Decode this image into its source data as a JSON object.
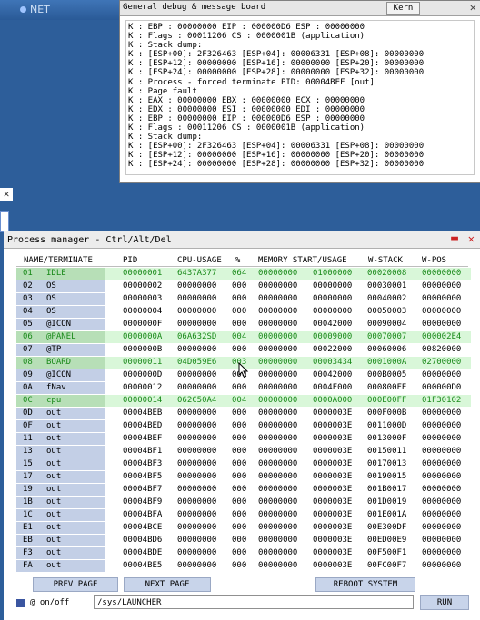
{
  "desktop": {
    "net_label": "NET"
  },
  "debug": {
    "title": "General debug & message board",
    "kern_label": "Kern",
    "close_glyph": "✕",
    "lines": [
      "K : EBP : 00000000 EIP : 000000D6 ESP : 00000000",
      "K : Flags : 00011206 CS : 0000001B (application)",
      "K : Stack dump:",
      "K : [ESP+00]: 2F326463 [ESP+04]: 00006331 [ESP+08]: 00000000",
      "K : [ESP+12]: 00000000 [ESP+16]: 00000000 [ESP+20]: 00000000",
      "K : [ESP+24]: 00000000 [ESP+28]: 00000000 [ESP+32]: 00000000",
      "K : Process - forced terminate PID: 00004BEF [out]",
      "K : Page fault",
      "K : EAX : 00000000 EBX : 00000000 ECX : 00000000",
      "K : EDX : 00000000 ESI : 00000000 EDI : 00000000",
      "K : EBP : 00000000 EIP : 000000D6 ESP : 00000000",
      "K : Flags : 00011206 CS : 0000001B (application)",
      "K : Stack dump:",
      "K : [ESP+00]: 2F326463 [ESP+04]: 00006331 [ESP+08]: 00000000",
      "K : [ESP+12]: 00000000 [ESP+16]: 00000000 [ESP+20]: 00000000",
      "K : [ESP+24]: 00000000 [ESP+28]: 00000000 [ESP+32]: 00000000"
    ]
  },
  "pm": {
    "title": "Process manager - Ctrl/Alt/Del",
    "minimize_glyph": "▬",
    "close_glyph": "✕",
    "headers": [
      "NAME/TERMINATE",
      "PID",
      "CPU-USAGE",
      "%",
      "MEMORY START/USAGE",
      "W-STACK",
      "W-POS"
    ],
    "rows": [
      {
        "id": "01",
        "name": "IDLE",
        "pid": "00000001",
        "cpu": "6437A377",
        "pct": "064",
        "mem1": "00000000",
        "mem2": "01000000",
        "wstack": "00020008",
        "wpos": "00000000",
        "hl": true
      },
      {
        "id": "02",
        "name": "OS",
        "pid": "00000002",
        "cpu": "00000000",
        "pct": "000",
        "mem1": "00000000",
        "mem2": "00000000",
        "wstack": "00030001",
        "wpos": "00000000",
        "hl": false
      },
      {
        "id": "03",
        "name": "OS",
        "pid": "00000003",
        "cpu": "00000000",
        "pct": "000",
        "mem1": "00000000",
        "mem2": "00000000",
        "wstack": "00040002",
        "wpos": "00000000",
        "hl": false
      },
      {
        "id": "04",
        "name": "OS",
        "pid": "00000004",
        "cpu": "00000000",
        "pct": "000",
        "mem1": "00000000",
        "mem2": "00000000",
        "wstack": "00050003",
        "wpos": "00000000",
        "hl": false
      },
      {
        "id": "05",
        "name": "@ICON",
        "pid": "0000000F",
        "cpu": "00000000",
        "pct": "000",
        "mem1": "00000000",
        "mem2": "00042000",
        "wstack": "00090004",
        "wpos": "00000000",
        "hl": false
      },
      {
        "id": "06",
        "name": "@PANEL",
        "pid": "0000000A",
        "cpu": "06A632SD",
        "pct": "004",
        "mem1": "00000000",
        "mem2": "00009000",
        "wstack": "00070007",
        "wpos": "000002E4",
        "hl": true
      },
      {
        "id": "07",
        "name": "@TP",
        "pid": "0000000B",
        "cpu": "00000000",
        "pct": "000",
        "mem1": "00000000",
        "mem2": "00022000",
        "wstack": "00060006",
        "wpos": "00820000",
        "hl": false
      },
      {
        "id": "08",
        "name": "BOARD",
        "pid": "00000011",
        "cpu": "04D059E6",
        "pct": "003",
        "mem1": "00000000",
        "mem2": "00003434",
        "wstack": "0001000A",
        "wpos": "02700000",
        "hl": true
      },
      {
        "id": "09",
        "name": "@ICON",
        "pid": "0000000D",
        "cpu": "00000000",
        "pct": "000",
        "mem1": "00000000",
        "mem2": "00042000",
        "wstack": "000B0005",
        "wpos": "00000000",
        "hl": false
      },
      {
        "id": "0A",
        "name": "fNav",
        "pid": "00000012",
        "cpu": "00000000",
        "pct": "000",
        "mem1": "00000000",
        "mem2": "0004F000",
        "wstack": "000800FE",
        "wpos": "000000D0",
        "hl": false
      },
      {
        "id": "0C",
        "name": "cpu",
        "pid": "00000014",
        "cpu": "062C50A4",
        "pct": "004",
        "mem1": "00000000",
        "mem2": "0000A000",
        "wstack": "000E00FF",
        "wpos": "01F30102",
        "hl": true
      },
      {
        "id": "0D",
        "name": "out",
        "pid": "00004BEB",
        "cpu": "00000000",
        "pct": "000",
        "mem1": "00000000",
        "mem2": "0000003E",
        "wstack": "000F000B",
        "wpos": "00000000",
        "hl": false
      },
      {
        "id": "0F",
        "name": "out",
        "pid": "00004BED",
        "cpu": "00000000",
        "pct": "000",
        "mem1": "00000000",
        "mem2": "0000003E",
        "wstack": "0011000D",
        "wpos": "00000000",
        "hl": false
      },
      {
        "id": "11",
        "name": "out",
        "pid": "00004BEF",
        "cpu": "00000000",
        "pct": "000",
        "mem1": "00000000",
        "mem2": "0000003E",
        "wstack": "0013000F",
        "wpos": "00000000",
        "hl": false
      },
      {
        "id": "13",
        "name": "out",
        "pid": "00004BF1",
        "cpu": "00000000",
        "pct": "000",
        "mem1": "00000000",
        "mem2": "0000003E",
        "wstack": "00150011",
        "wpos": "00000000",
        "hl": false
      },
      {
        "id": "15",
        "name": "out",
        "pid": "00004BF3",
        "cpu": "00000000",
        "pct": "000",
        "mem1": "00000000",
        "mem2": "0000003E",
        "wstack": "00170013",
        "wpos": "00000000",
        "hl": false
      },
      {
        "id": "17",
        "name": "out",
        "pid": "00004BF5",
        "cpu": "00000000",
        "pct": "000",
        "mem1": "00000000",
        "mem2": "0000003E",
        "wstack": "00190015",
        "wpos": "00000000",
        "hl": false
      },
      {
        "id": "19",
        "name": "out",
        "pid": "00004BF7",
        "cpu": "00000000",
        "pct": "000",
        "mem1": "00000000",
        "mem2": "0000003E",
        "wstack": "001B0017",
        "wpos": "00000000",
        "hl": false
      },
      {
        "id": "1B",
        "name": "out",
        "pid": "00004BF9",
        "cpu": "00000000",
        "pct": "000",
        "mem1": "00000000",
        "mem2": "0000003E",
        "wstack": "001D0019",
        "wpos": "00000000",
        "hl": false
      },
      {
        "id": "1C",
        "name": "out",
        "pid": "00004BFA",
        "cpu": "00000000",
        "pct": "000",
        "mem1": "00000000",
        "mem2": "0000003E",
        "wstack": "001E001A",
        "wpos": "00000000",
        "hl": false
      },
      {
        "id": "E1",
        "name": "out",
        "pid": "00004BCE",
        "cpu": "00000000",
        "pct": "000",
        "mem1": "00000000",
        "mem2": "0000003E",
        "wstack": "00E300DF",
        "wpos": "00000000",
        "hl": false
      },
      {
        "id": "EB",
        "name": "out",
        "pid": "00004BD6",
        "cpu": "00000000",
        "pct": "000",
        "mem1": "00000000",
        "mem2": "0000003E",
        "wstack": "00ED00E9",
        "wpos": "00000000",
        "hl": false
      },
      {
        "id": "F3",
        "name": "out",
        "pid": "00004BDE",
        "cpu": "00000000",
        "pct": "000",
        "mem1": "00000000",
        "mem2": "0000003E",
        "wstack": "00F500F1",
        "wpos": "00000000",
        "hl": false
      },
      {
        "id": "FA",
        "name": "out",
        "pid": "00004BE5",
        "cpu": "00000000",
        "pct": "000",
        "mem1": "00000000",
        "mem2": "0000003E",
        "wstack": "00FC00F7",
        "wpos": "00000000",
        "hl": false
      }
    ],
    "buttons": {
      "prev": "PREV PAGE",
      "next": "NEXT PAGE",
      "reboot": "REBOOT SYSTEM",
      "run": "RUN"
    },
    "onoff_label": "@ on/off",
    "launcher_value": "/sys/LAUNCHER"
  }
}
